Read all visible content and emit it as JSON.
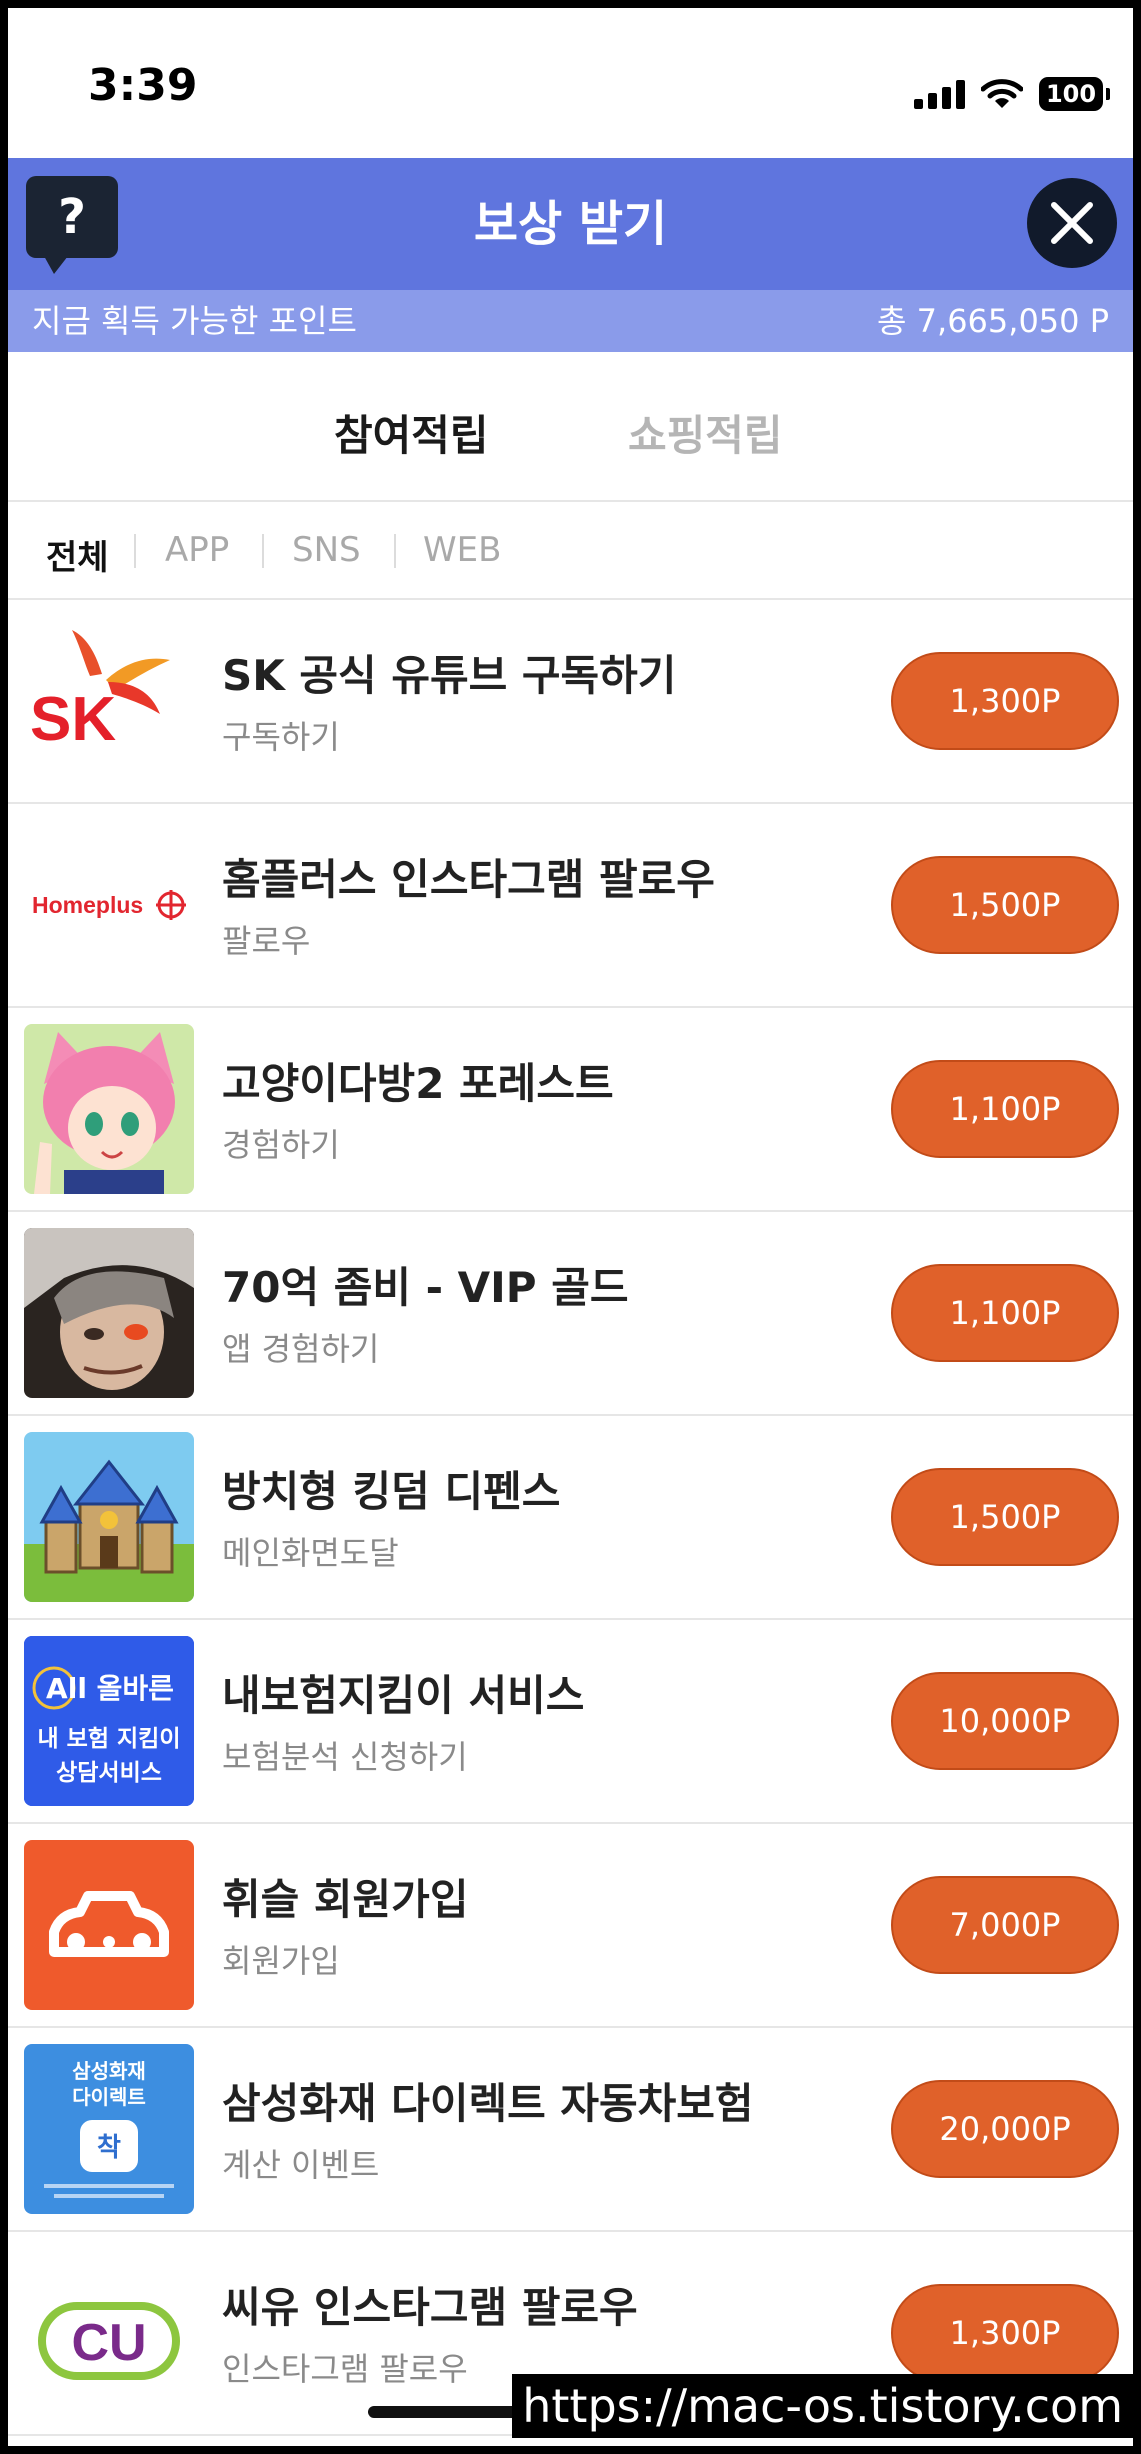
{
  "status_bar": {
    "time": "3:39",
    "battery": "100"
  },
  "header": {
    "title": "보상 받기",
    "help_label": "?"
  },
  "points": {
    "label": "지금 획득 가능한 포인트",
    "total": "총 7,665,050 P"
  },
  "main_tabs": [
    {
      "label": "참여적립",
      "active": true
    },
    {
      "label": "쇼핑적립",
      "active": false
    }
  ],
  "filters": [
    {
      "label": "전체",
      "active": true
    },
    {
      "label": "APP"
    },
    {
      "label": "SNS"
    },
    {
      "label": "WEB"
    }
  ],
  "offers": [
    {
      "title": "SK 공식 유튜브 구독하기",
      "subtitle": "구독하기",
      "reward": "1,300P",
      "logo": "sk-logo"
    },
    {
      "title": "홈플러스 인스타그램 팔로우",
      "subtitle": "팔로우",
      "reward": "1,500P",
      "logo": "homeplus-logo",
      "logo_text": "Homeplus"
    },
    {
      "title": "고양이다방2 포레스트",
      "subtitle": "경험하기",
      "reward": "1,100P",
      "logo": "cat-girl-app-icon"
    },
    {
      "title": "70억 좀비 - VIP 골드",
      "subtitle": "앱 경험하기",
      "reward": "1,100P",
      "logo": "zombie-app-icon"
    },
    {
      "title": "방치형 킹덤 디펜스",
      "subtitle": "메인화면도달",
      "reward": "1,500P",
      "logo": "castle-app-icon"
    },
    {
      "title": "내보험지킴이 서비스",
      "subtitle": "보험분석 신청하기",
      "reward": "10,000P",
      "logo": "insurance-app-icon",
      "logo_text": [
        "All 올바른",
        "내 보험 지킴이",
        "상담서비스"
      ]
    },
    {
      "title": "휘슬 회원가입",
      "subtitle": "회원가입",
      "reward": "7,000P",
      "logo": "car-app-icon"
    },
    {
      "title": "삼성화재 다이렉트 자동차보험",
      "subtitle": "계산 이벤트",
      "reward": "20,000P",
      "logo": "samsung-fire-icon",
      "logo_text": [
        "삼성화재",
        "다이렉트",
        "착"
      ]
    },
    {
      "title": "씨유 인스타그램 팔로우",
      "subtitle": "인스타그램 팔로우",
      "reward": "1,300P",
      "logo": "cu-logo",
      "logo_text": "CU"
    }
  ],
  "watermark": "https://mac-os.tistory.com",
  "colors": {
    "header": "#5f75de",
    "points_bar": "#8a9bea",
    "reward_button": "#e0612a"
  }
}
